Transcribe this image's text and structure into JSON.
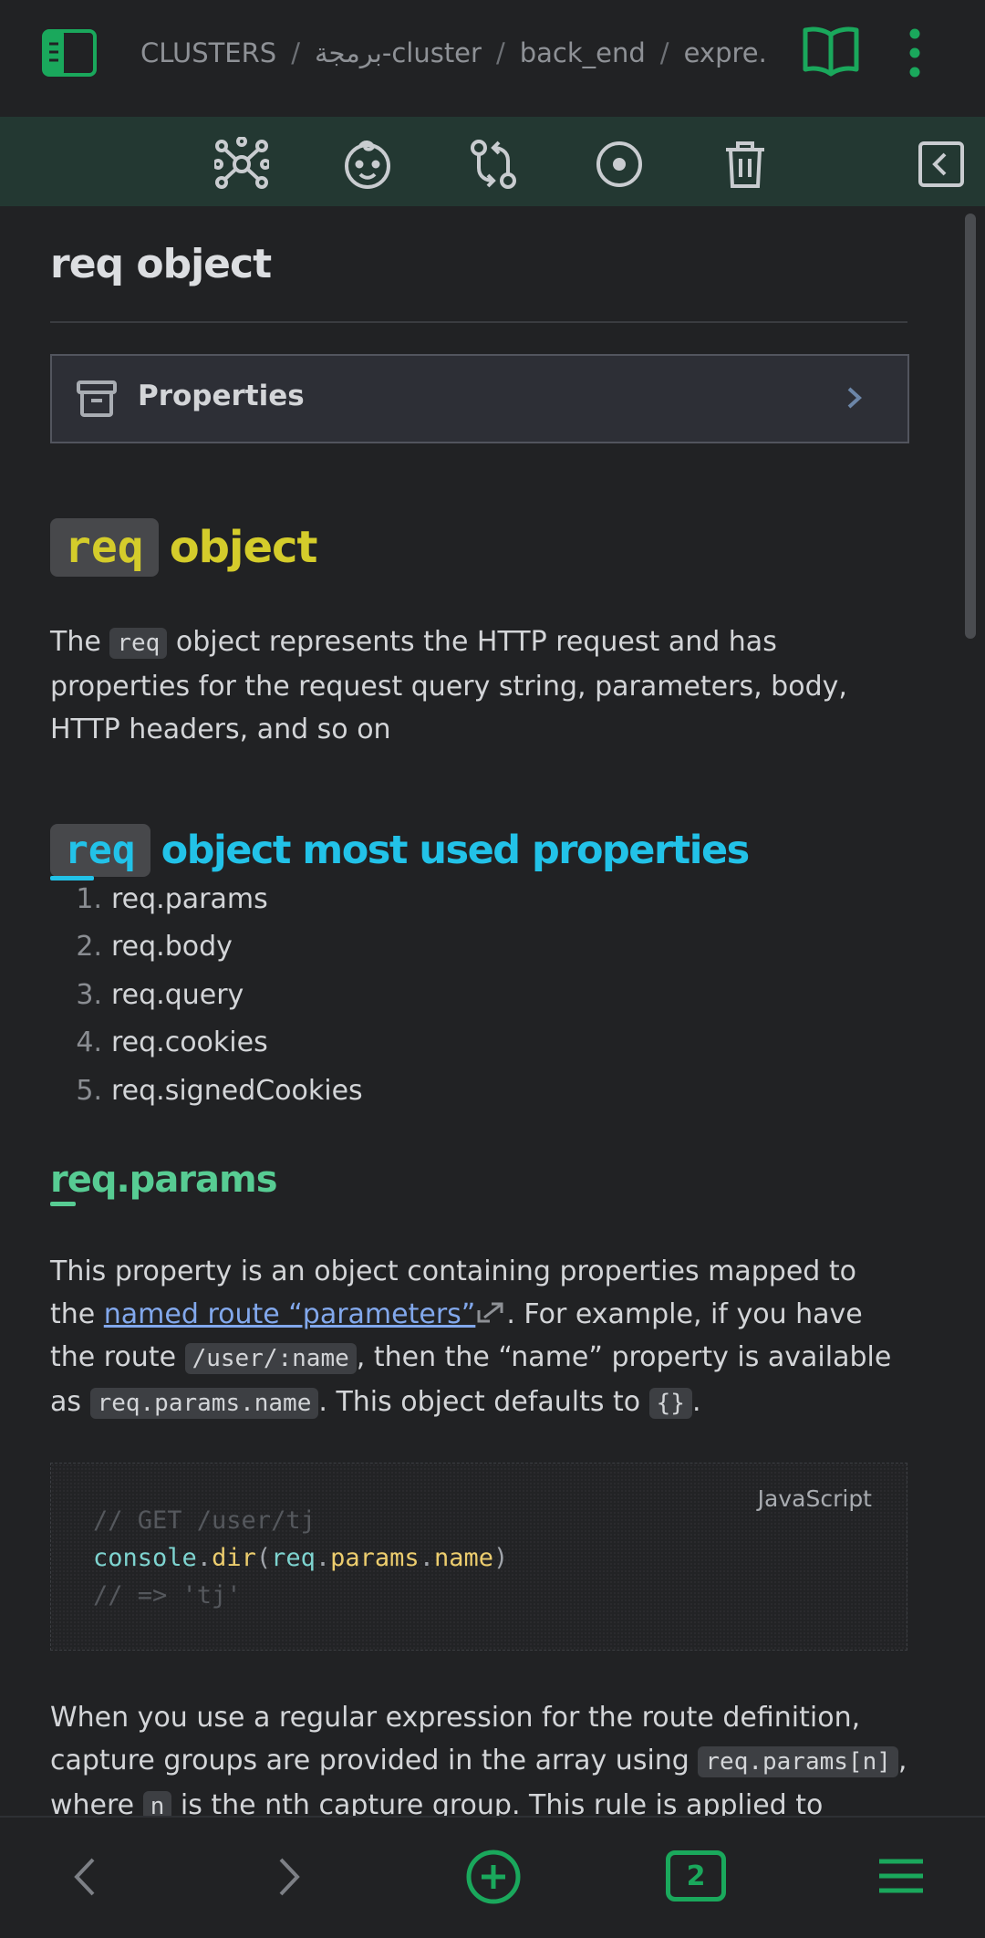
{
  "breadcrumb": {
    "items": [
      "CLUSTERS",
      "برمجة-cluster",
      "back_end",
      "expre..."
    ]
  },
  "colors": {
    "accent": "#1aa85c",
    "toolbar_bg": "#233832",
    "h1": "#d4cc2b",
    "h2": "#22c2e8",
    "h3": "#57cc93"
  },
  "toolbar": {
    "icons": [
      "graph-icon",
      "face-icon",
      "git-compare-icon",
      "record-icon",
      "trash-icon",
      "collapse-left-icon"
    ]
  },
  "page": {
    "title": "req object",
    "properties_label": "Properties"
  },
  "section1": {
    "chip": "req",
    "heading": "object",
    "para_pre": "The ",
    "para_chip": "req",
    "para_post": " object represents the HTTP request and has properties for the request query string, parameters, body, HTTP headers, and so on"
  },
  "section2": {
    "chip": "req",
    "heading": "object most used properties",
    "items": [
      "req.params",
      "req.body",
      "req.query",
      "req.cookies",
      "req.signedCookies"
    ]
  },
  "section3": {
    "heading": "req.params",
    "p1_a": "This property is an object containing properties mapped to the ",
    "p1_link": "named route “parameters”",
    "p1_b": ". For example, if you have the route ",
    "p1_chip1": "/user/:name",
    "p1_c": ", then the “name” property is available as ",
    "p1_chip2": "req.params.name",
    "p1_d": ". This object defaults to ",
    "p1_chip3": "{}",
    "p1_e": "."
  },
  "code": {
    "language": "JavaScript",
    "line1": "// GET /user/tj",
    "l2_obj": "console",
    "l2_dot1": ".",
    "l2_fn": "dir",
    "l2_paren1": "(",
    "l2_a": "req",
    "l2_dot2": ".",
    "l2_b": "params",
    "l2_dot3": ".",
    "l2_c": "name",
    "l2_paren2": ")",
    "line3": "// => 'tj'"
  },
  "section4": {
    "p_a": "When you use a regular expression for the route definition, capture groups are provided in the array using ",
    "p_chip1": "req.params[n]",
    "p_b": ", where ",
    "p_chip2": "n",
    "p_c": " is the nth capture group. This rule is applied to"
  },
  "bottom": {
    "tabs_count": "2"
  }
}
